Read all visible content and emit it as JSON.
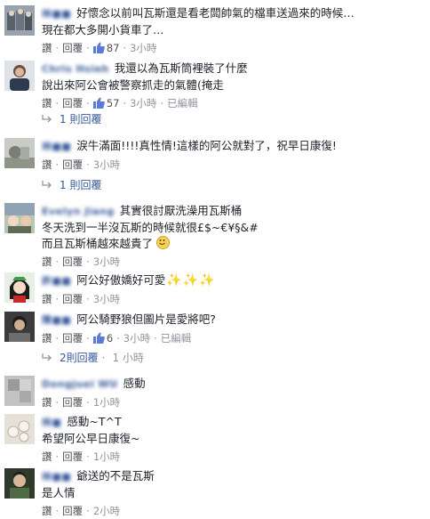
{
  "ui": {
    "like_label": "讚",
    "reply_label": "回覆",
    "separator": "·"
  },
  "comments": [
    {
      "author": "林■■",
      "lines": [
        "好懷念以前叫瓦斯還是看老闆帥氣的檔車送過來的時候…",
        "現在都大多開小貨車了…"
      ],
      "likes": "87",
      "time": "3小時",
      "edited": ""
    },
    {
      "author": "Chris Hsieh",
      "lines": [
        "我還以為瓦斯筒裡裝了什麼",
        "說出來阿公會被警察抓走的氣體(掩走"
      ],
      "likes": "57",
      "time": "3小時",
      "edited": "已編輯",
      "replies": {
        "label": "1 則回覆",
        "time": ""
      }
    },
    {
      "author": "林■■",
      "lines": [
        "淚牛滿面!!!!真性情!這樣的阿公就對了，祝早日康復!"
      ],
      "likes": "",
      "time": "3小時",
      "edited": "",
      "replies": {
        "label": "1 則回覆",
        "time": ""
      }
    },
    {
      "author": "Evelyn Jiang",
      "lines": [
        "其實很討厭洗澡用瓦斯桶",
        "冬天洗到一半沒瓦斯的時候就很£$~€¥§&#",
        "而且瓦斯桶越來越貴了"
      ],
      "likes": "",
      "time": "3小時",
      "edited": ""
    },
    {
      "author": "許■■",
      "lines": [
        "阿公好傲嬌好可愛"
      ],
      "likes": "",
      "time": "3小時",
      "edited": ""
    },
    {
      "author": "陳■■",
      "lines": [
        "阿公騎野狼但圖片是愛將吧?"
      ],
      "likes": "6",
      "time": "3小時",
      "edited": "已編輯",
      "replies": {
        "label": "2則回覆",
        "time": "1 小時"
      }
    },
    {
      "author": "Dongjuei WU",
      "lines": [
        "感動"
      ],
      "likes": "",
      "time": "1小時",
      "edited": ""
    },
    {
      "author": "林■",
      "lines": [
        "感動~T^T",
        "希望阿公早日康復~"
      ],
      "likes": "",
      "time": "1小時",
      "edited": ""
    },
    {
      "author": "林■■",
      "lines": [
        "爺送的不是瓦斯",
        "是人情"
      ],
      "likes": "",
      "time": "2小時",
      "edited": ""
    }
  ]
}
